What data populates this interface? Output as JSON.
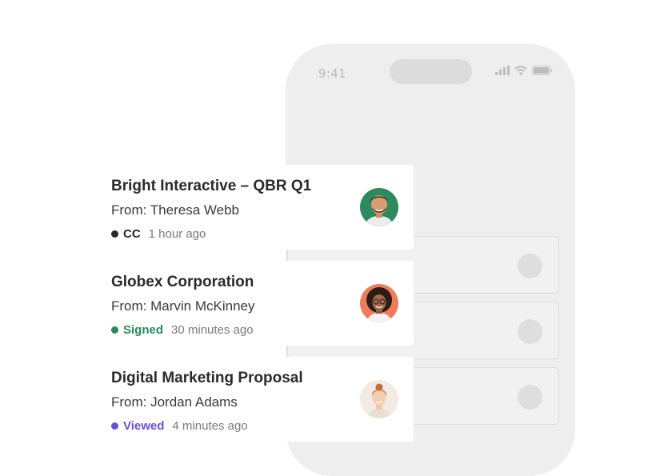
{
  "phone": {
    "time": "9:41"
  },
  "cards": [
    {
      "title": "Bright Interactive – QBR Q1",
      "from": "From: Theresa Webb",
      "status": "CC",
      "status_color": "#2a2a2a",
      "time_ago": "1 hour ago",
      "avatar_bg": "#2d8a5e"
    },
    {
      "title": "Globex Corporation",
      "from": "From: Marvin McKinney",
      "status": "Signed",
      "status_color": "#2a8a58",
      "time_ago": "30 minutes ago",
      "avatar_bg": "#ef7a5c"
    },
    {
      "title": "Digital Marketing Proposal",
      "from": "From: Jordan Adams",
      "status": "Viewed",
      "status_color": "#6a4ed9",
      "time_ago": "4 minutes ago",
      "avatar_bg": "#f2ebe3"
    }
  ]
}
